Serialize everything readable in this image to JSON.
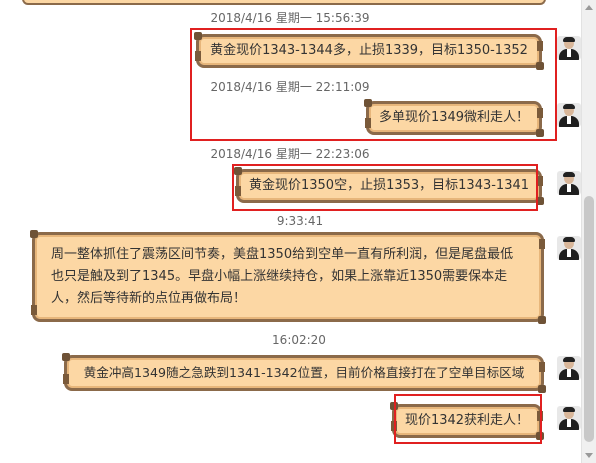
{
  "messages": [
    {
      "timestamp": "2018/4/16 星期一 15:56:39",
      "text": "黄金现价1343-1344多，止损1339，目标1350-1352"
    },
    {
      "timestamp": "2018/4/16 星期一 22:11:09",
      "text": "多单现价1349微利走人！"
    },
    {
      "timestamp": "2018/4/16 星期一 22:23:06",
      "text": "黄金现价1350空，止损1353，目标1343-1341"
    },
    {
      "timestamp": "9:33:41",
      "text": "周一整体抓住了震荡区间节奏，美盘1350给到空单一直有所利润，但是尾盘最低也只是触及到了1345。早盘小幅上涨继续持仓，如果上涨靠近1350需要保本走人，然后等待新的点位再做布局！"
    },
    {
      "timestamp": "16:02:20",
      "text": "黄金冲高1349随之急跌到1341-1342位置，目前价格直接打在了空单目标区域"
    },
    {
      "timestamp": "",
      "text": "现价1342获利走人！"
    }
  ]
}
